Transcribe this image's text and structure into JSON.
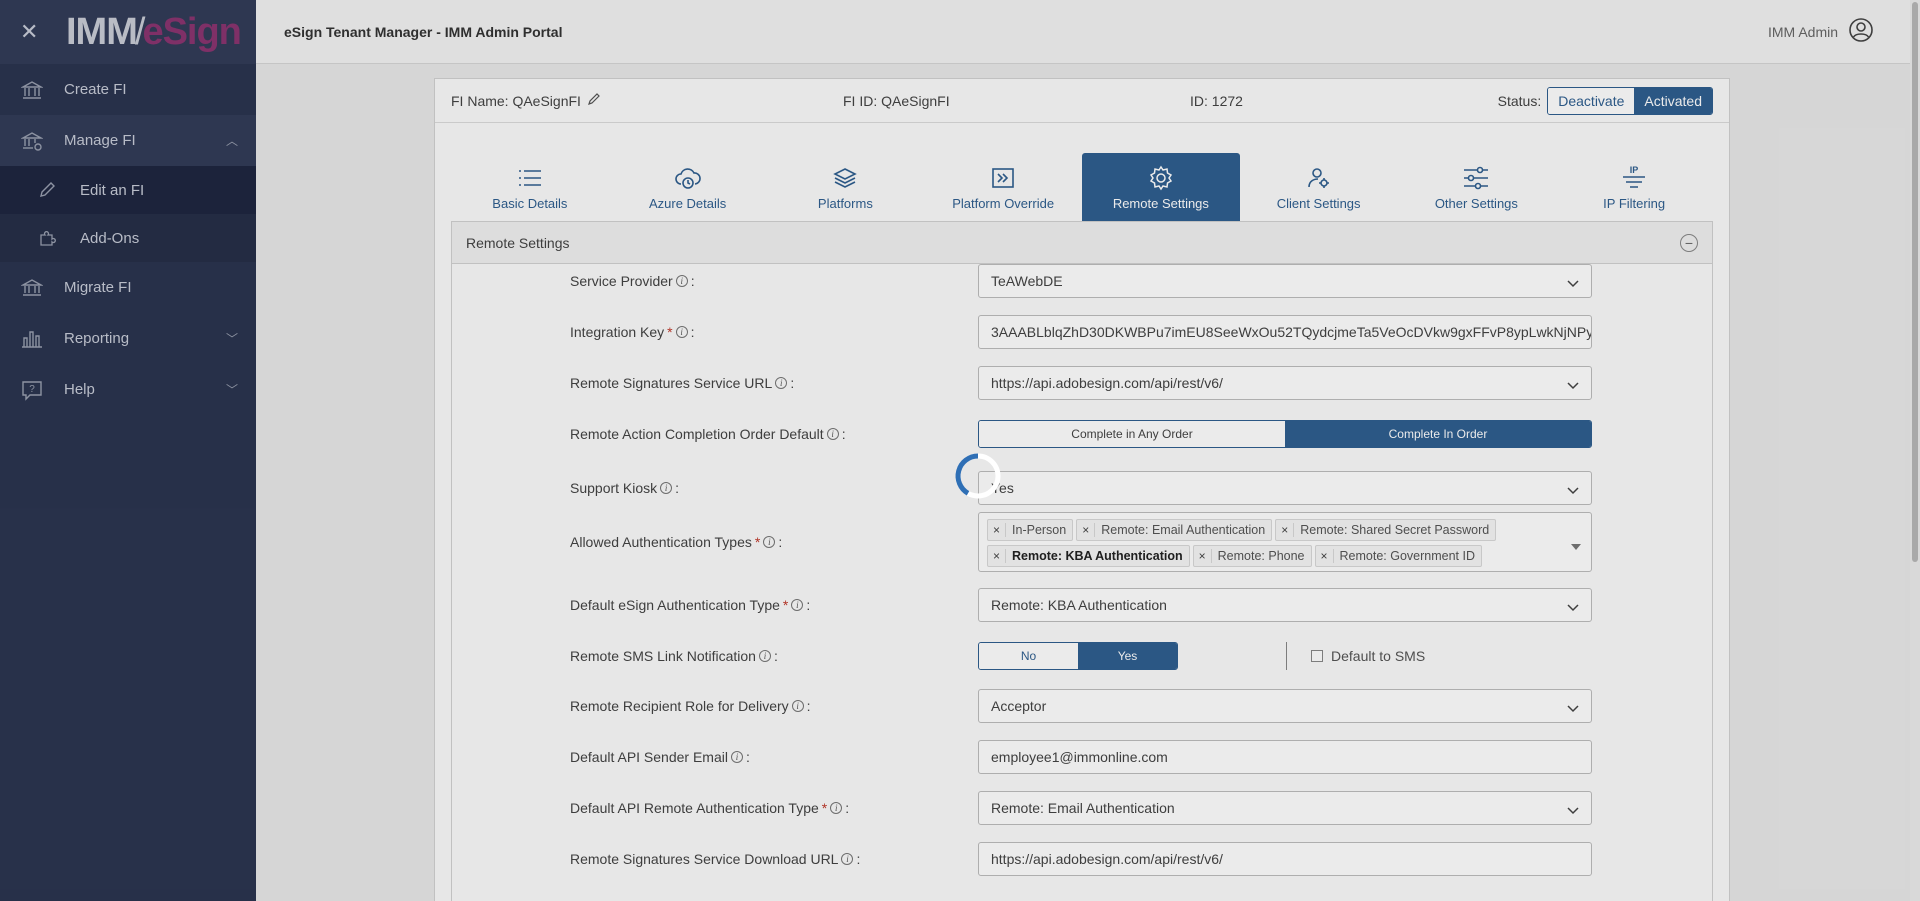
{
  "sidebar": {
    "logo_left": "IMM",
    "logo_right": "eSign",
    "items": [
      {
        "label": "Create FI",
        "icon": "bank-icon"
      },
      {
        "label": "Manage FI",
        "icon": "bank-settings-icon"
      },
      {
        "label": "Edit an FI",
        "icon": "pencil-icon"
      },
      {
        "label": "Add-Ons",
        "icon": "puzzle-icon"
      },
      {
        "label": "Migrate FI",
        "icon": "bank-transfer-icon"
      },
      {
        "label": "Reporting",
        "icon": "bar-chart-icon"
      },
      {
        "label": "Help",
        "icon": "help-chat-icon"
      }
    ]
  },
  "header": {
    "title": "eSign Tenant Manager - IMM Admin Portal",
    "user": "IMM Admin"
  },
  "fi_info": {
    "name": "FI Name: QAeSignFI",
    "fi_id": "FI ID: QAeSignFI",
    "id": "ID: 1272",
    "status_label": "Status:",
    "deactivate": "Deactivate",
    "activated": "Activated"
  },
  "tabs": [
    {
      "label": "Basic Details",
      "icon": "list-icon"
    },
    {
      "label": "Azure Details",
      "icon": "cloud-icon"
    },
    {
      "label": "Platforms",
      "icon": "layers-icon"
    },
    {
      "label": "Platform Override",
      "icon": "override-icon"
    },
    {
      "label": "Remote Settings",
      "icon": "gear-icon"
    },
    {
      "label": "Client Settings",
      "icon": "user-gear-icon"
    },
    {
      "label": "Other Settings",
      "icon": "sliders-icon"
    },
    {
      "label": "IP Filtering",
      "icon": "ip-filter-icon"
    }
  ],
  "section": {
    "title": "Remote Settings"
  },
  "form": {
    "service_provider": {
      "label": "Service Provider",
      "value": "TeAWebDE"
    },
    "integration_key": {
      "label": "Integration Key",
      "value": "3AAABLblqZhD30DKWBPu7imEU8SeeWxOu52TQydcjmeTa5VeOcDVkw9gxFFvP8ypLwkNjNPy"
    },
    "remote_sig_url": {
      "label": "Remote Signatures Service URL",
      "value": "https://api.adobesign.com/api/rest/v6/"
    },
    "completion_order": {
      "label": "Remote Action Completion Order Default",
      "option_a": "Complete in Any Order",
      "option_b": "Complete In Order"
    },
    "support_kiosk": {
      "label": "Support Kiosk",
      "value": "Yes"
    },
    "auth_types": {
      "label": "Allowed Authentication Types",
      "tags": [
        "In-Person",
        "Remote: Email Authentication",
        "Remote: Shared Secret Password",
        "Remote: KBA Authentication",
        "Remote: Phone",
        "Remote: Government ID"
      ]
    },
    "default_auth": {
      "label": "Default eSign Authentication Type",
      "value": "Remote: KBA Authentication"
    },
    "sms_link": {
      "label": "Remote SMS Link Notification",
      "no": "No",
      "yes": "Yes",
      "default_sms": "Default to SMS"
    },
    "recipient_role": {
      "label": "Remote Recipient Role for Delivery",
      "value": "Acceptor"
    },
    "sender_email": {
      "label": "Default API Sender Email",
      "value": "employee1@immonline.com"
    },
    "api_remote_auth": {
      "label": "Default API Remote Authentication Type",
      "value": "Remote: Email Authentication"
    },
    "download_url": {
      "label": "Remote Signatures Service Download URL",
      "value": "https://api.adobesign.com/api/rest/v6/"
    }
  },
  "colors": {
    "primary": "#2f5f90",
    "sidebar": "#2b3550",
    "brand": "#8a3570"
  }
}
